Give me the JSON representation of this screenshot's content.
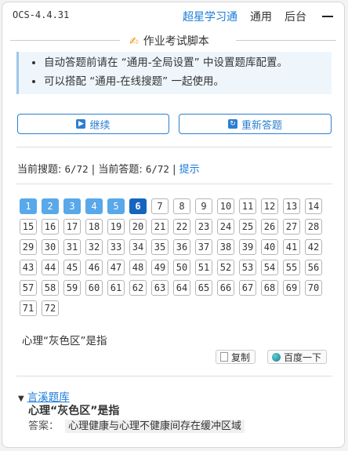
{
  "header": {
    "version": "OCS-4.4.31",
    "nav": [
      "超星学习通",
      "通用",
      "后台"
    ]
  },
  "section": {
    "icon": "writing-hand-icon",
    "title": "作业考试脚本"
  },
  "notice": {
    "items": [
      "自动答题前请在 “通用-全局设置” 中设置题库配置。",
      "可以搭配 “通用-在线搜题” 一起使用。"
    ]
  },
  "buttons": {
    "continue_label": "继续",
    "reanswer_label": "重新答题"
  },
  "status": {
    "search_label": "当前搜题:",
    "search_value": "6/72",
    "sep": "|",
    "answer_label": "当前答题:",
    "answer_value": "6/72",
    "hint": "提示"
  },
  "questions": {
    "total": 72,
    "done": [
      1,
      2,
      3,
      4,
      5
    ],
    "current": 6
  },
  "current_question": {
    "text": "心理“灰色区”是指",
    "copy_label": "复制",
    "baidu_label": "百度一下"
  },
  "result": {
    "source_name": "言溪题库",
    "question": "心理“灰色区”是指",
    "answer_label": "答案：",
    "answer_value": "心理健康与心理不健康间存在缓冲区域"
  },
  "colors": {
    "accent": "#1a7ad8",
    "done": "#58a8ea",
    "current": "#1565c0"
  }
}
